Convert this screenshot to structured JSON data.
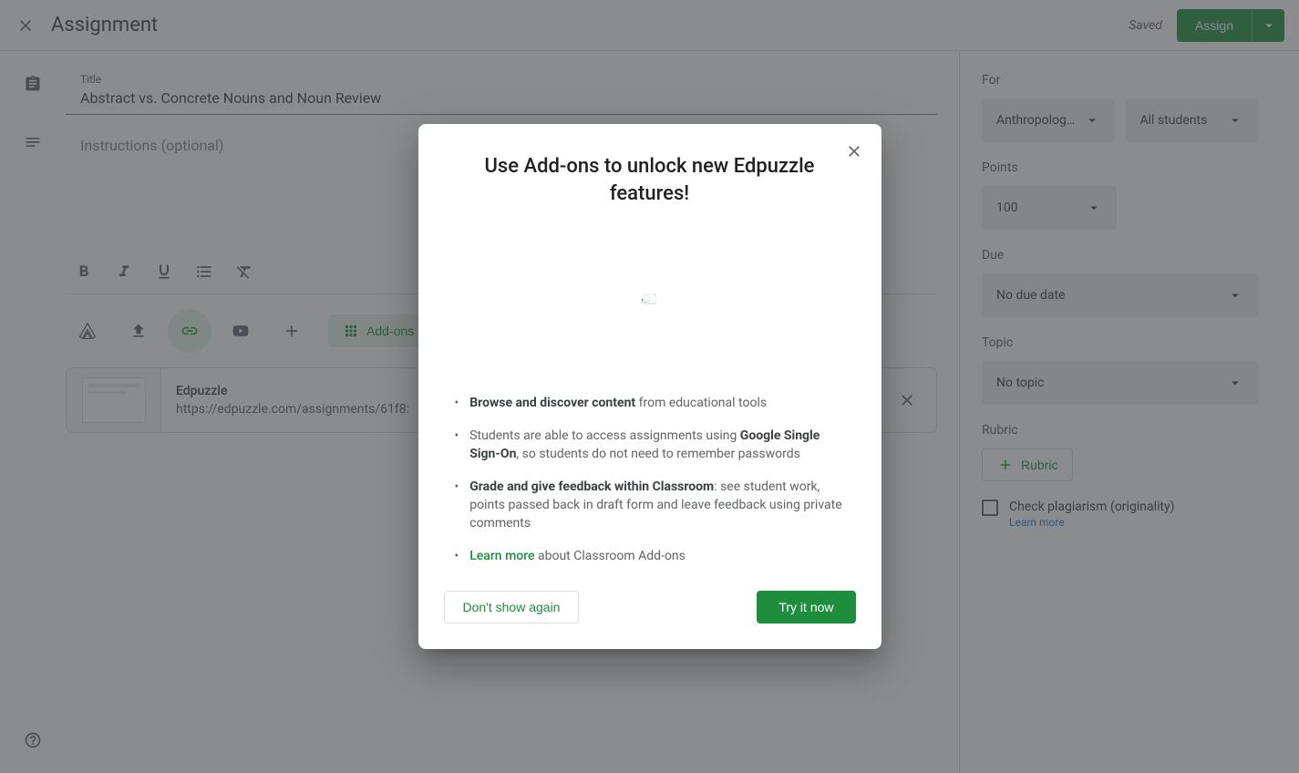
{
  "header": {
    "page_title": "Assignment",
    "saved_label": "Saved",
    "assign_label": "Assign"
  },
  "main": {
    "title_field_label": "Title",
    "title_value": "Abstract vs. Concrete Nouns and Noun Review",
    "instructions_placeholder": "Instructions (optional)",
    "addons_button_label": "Add-ons",
    "attachment": {
      "title": "Edpuzzle",
      "url": "https://edpuzzle.com/assignments/61f8:"
    }
  },
  "sidebar": {
    "for_label": "For",
    "class_value": "Anthropolog…",
    "students_value": "All students",
    "points_label": "Points",
    "points_value": "100",
    "due_label": "Due",
    "due_value": "No due date",
    "topic_label": "Topic",
    "topic_value": "No topic",
    "rubric_label": "Rubric",
    "rubric_button_label": "Rubric",
    "plagiarism_label": "Check plagiarism (originality)",
    "plagiarism_learn_more": "Learn more"
  },
  "modal": {
    "title": "Use Add-ons to unlock new Edpuzzle features!",
    "bullet1_strong": "Browse and discover content",
    "bullet1_rest": "  from educational tools",
    "bullet2_pre": "Students are able to access assignments using ",
    "bullet2_strong": "Google Single Sign-On",
    "bullet2_post": ", so students do not need to remember passwords",
    "bullet3_strong": " Grade and give feedback within Classroom",
    "bullet3_post": ": see student work, points passed back in draft form and leave feedback using private comments",
    "bullet4_link": "Learn more",
    "bullet4_post": " about Classroom Add-ons",
    "dont_show_label": "Don't show again",
    "try_now_label": "Try it now"
  }
}
